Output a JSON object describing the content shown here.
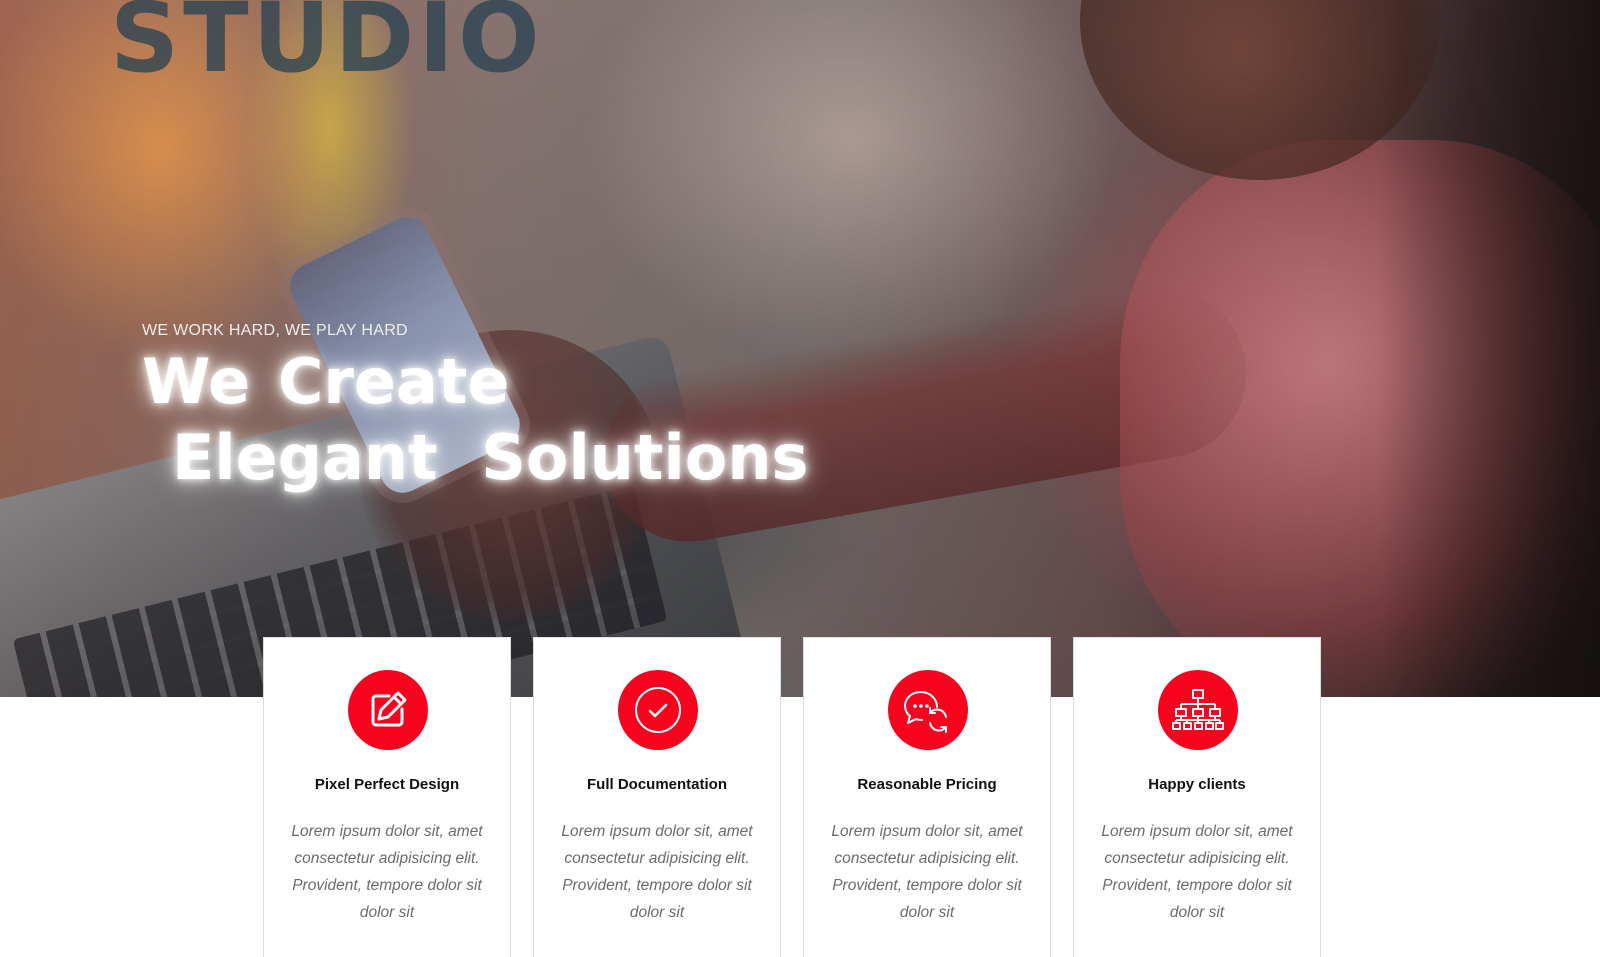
{
  "brand": {
    "name": "STUDIO"
  },
  "hero": {
    "tagline": "WE WORK HARD, WE PLAY HARD",
    "headline_line1": "We Create",
    "headline_line2": "Elegant Solutions"
  },
  "colors": {
    "accent": "#f7031d",
    "title_text": "#111111",
    "body_text": "#6b6b6b"
  },
  "features": [
    {
      "icon": "edit-icon",
      "title": "Pixel Perfect Design",
      "text": "Lorem ipsum dolor sit, amet consectetur adipisicing elit. Provident, tempore dolor sit dolor sit"
    },
    {
      "icon": "check-circle-icon",
      "title": "Full Documentation",
      "text": "Lorem ipsum dolor sit, amet consectetur adipisicing elit. Provident, tempore dolor sit dolor sit"
    },
    {
      "icon": "chat-refresh-icon",
      "title": "Reasonable Pricing",
      "text": "Lorem ipsum dolor sit, amet consectetur adipisicing elit. Provident, tempore dolor sit dolor sit"
    },
    {
      "icon": "sitemap-icon",
      "title": "Happy clients",
      "text": "Lorem ipsum dolor sit, amet consectetur adipisicing elit. Provident, tempore dolor sit dolor sit"
    }
  ]
}
